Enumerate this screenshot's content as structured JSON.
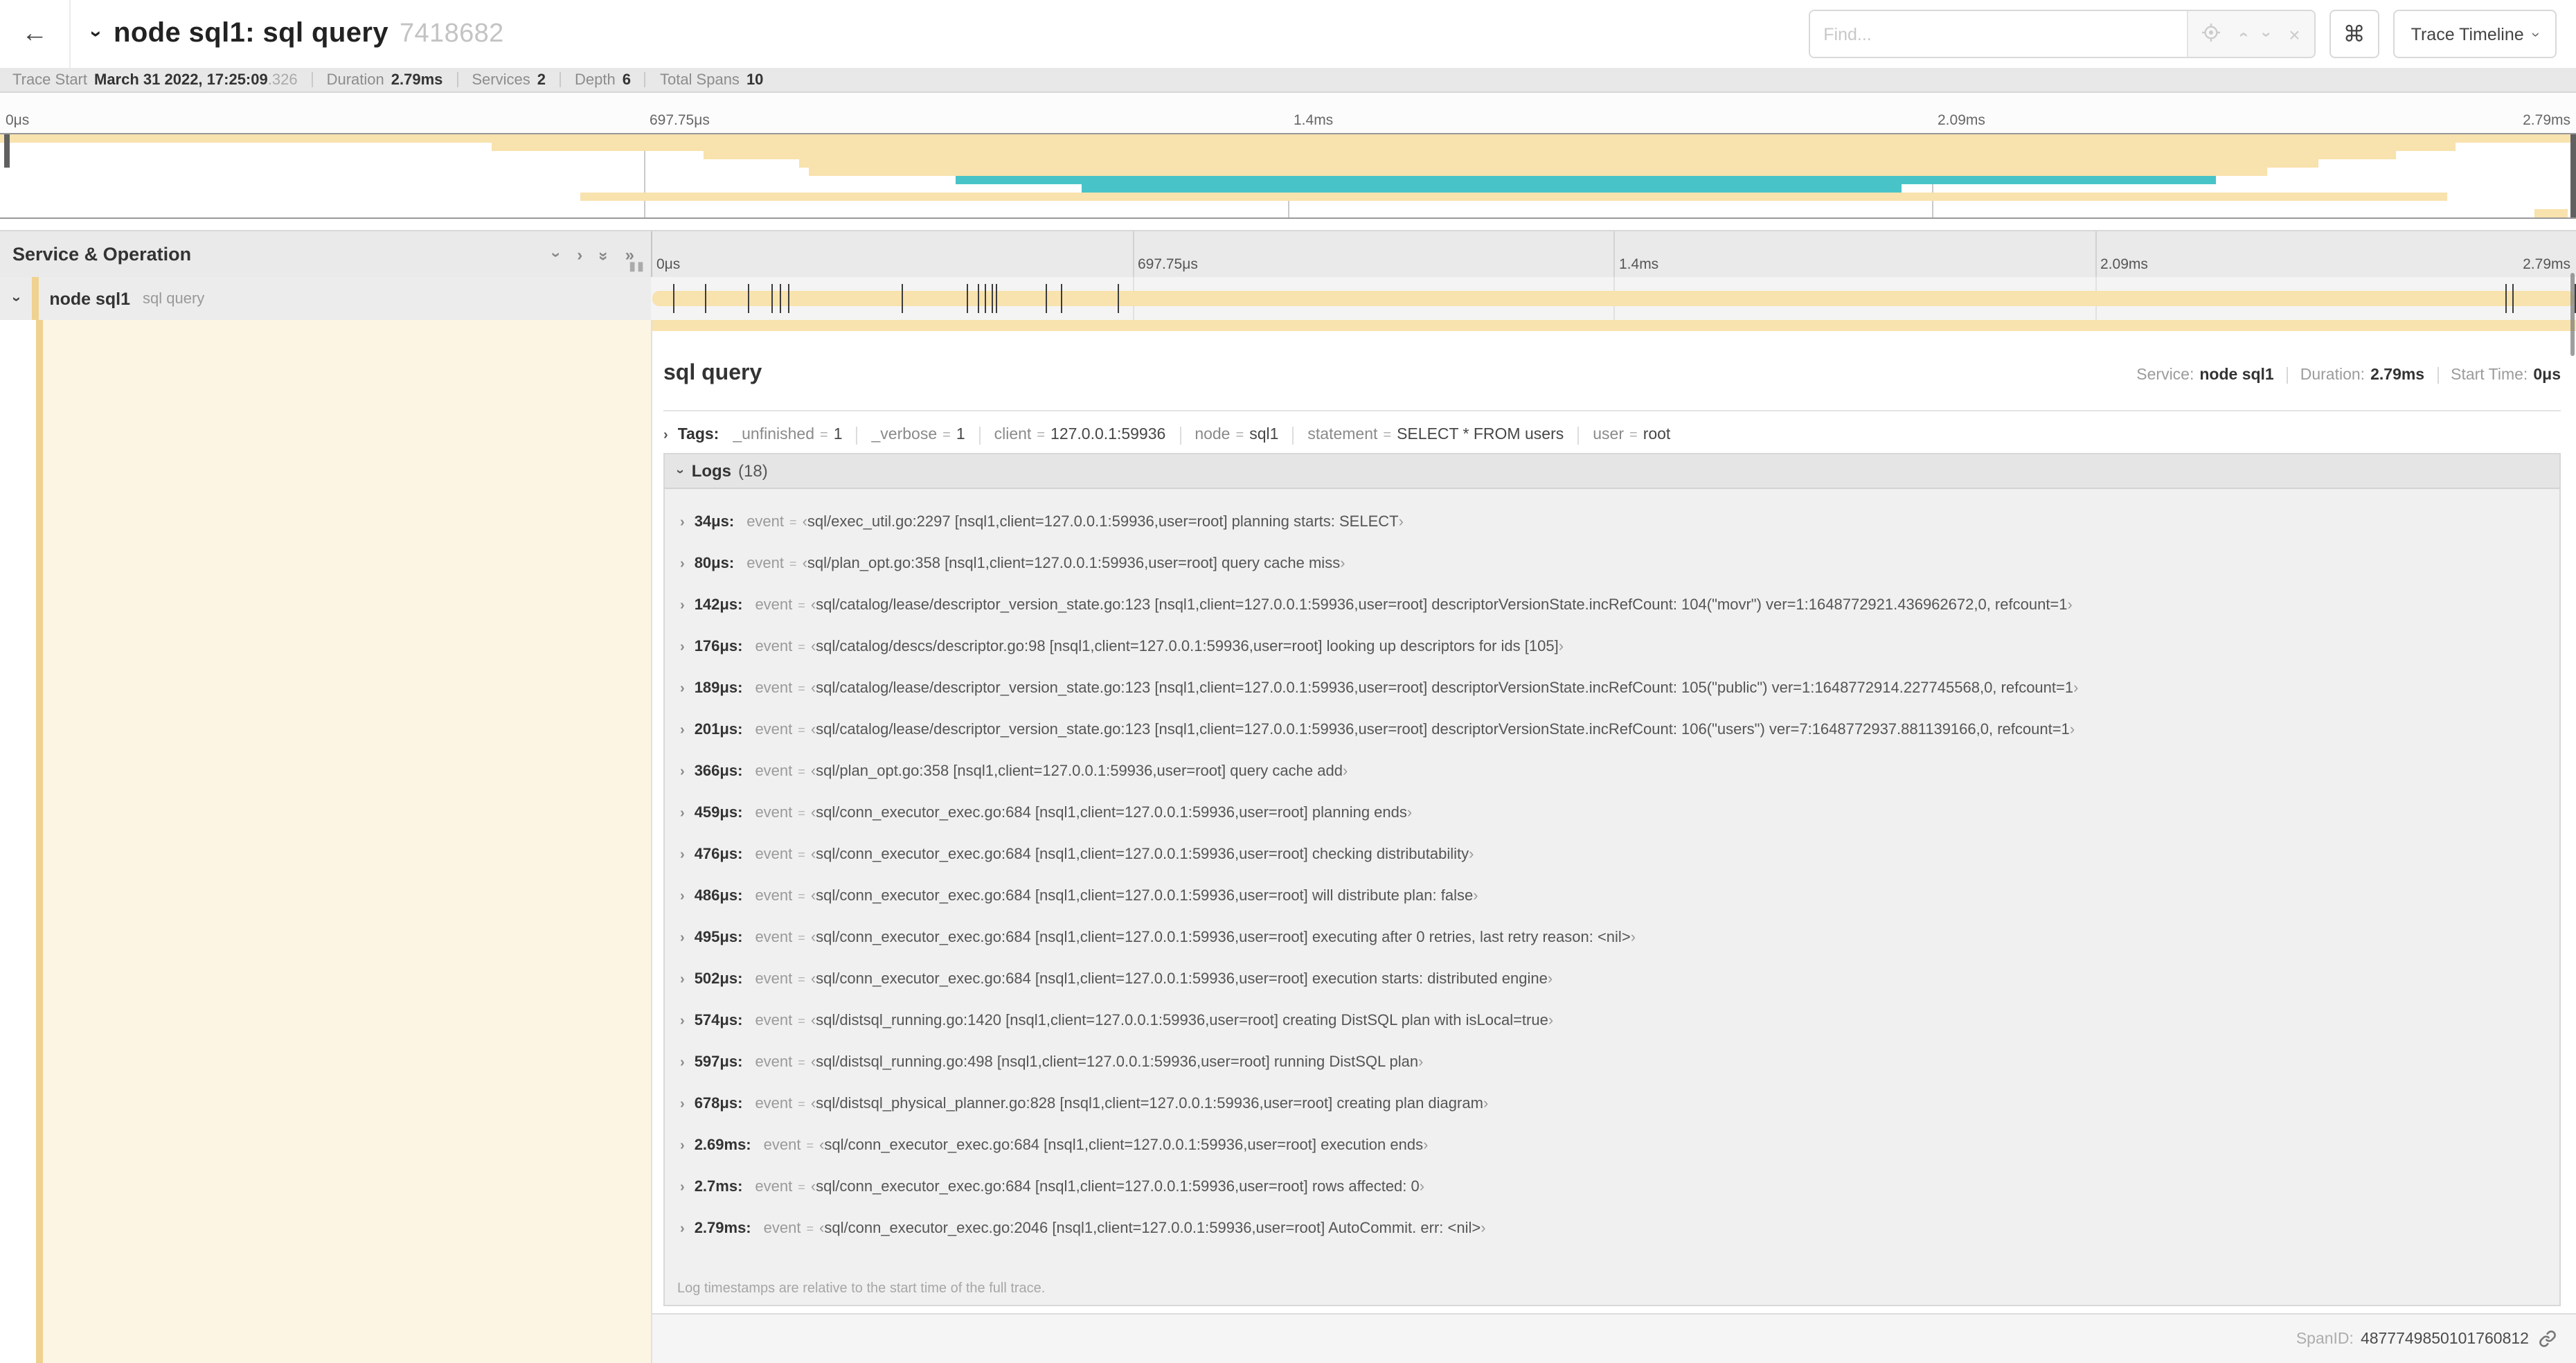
{
  "colors": {
    "tan_bar": "#f8e2ad",
    "tan_accent": "#efd28f",
    "teal": "#48c4c8",
    "cream": "#fdf5e3"
  },
  "header": {
    "back_icon": "←",
    "collapse_icon": "›",
    "title": "node sql1: sql query",
    "trace_id_short": "7418682",
    "find_placeholder": "Find...",
    "cmd_symbol": "⌘",
    "view_dropdown": "Trace Timeline"
  },
  "summary": {
    "items": [
      {
        "label": "Trace Start",
        "value": "March 31 2022, 17:25:09",
        "suffix": ".326"
      },
      {
        "label": "Duration",
        "value": "2.79ms",
        "suffix": ""
      },
      {
        "label": "Services",
        "value": "2",
        "suffix": ""
      },
      {
        "label": "Depth",
        "value": "6",
        "suffix": ""
      },
      {
        "label": "Total Spans",
        "value": "10",
        "suffix": ""
      }
    ]
  },
  "axis": {
    "labels": [
      {
        "text": "0μs",
        "pos": 0
      },
      {
        "text": "697.75μs",
        "pos": 25
      },
      {
        "text": "1.4ms",
        "pos": 50
      },
      {
        "text": "2.09ms",
        "pos": 75
      },
      {
        "text": "2.79ms",
        "pos": 100
      }
    ],
    "gridlines": [
      25,
      50,
      75,
      100
    ]
  },
  "minimap": {
    "rows": [
      {
        "row": 0,
        "start": 0,
        "end": 100,
        "color": "tan"
      },
      {
        "row": 1,
        "start": 19.1,
        "end": 95.3,
        "color": "tan"
      },
      {
        "row": 2,
        "start": 27.3,
        "end": 93,
        "color": "tan"
      },
      {
        "row": 3,
        "start": 31,
        "end": 90,
        "color": "tan"
      },
      {
        "row": 4,
        "start": 31.4,
        "end": 88,
        "color": "tan"
      },
      {
        "row": 5,
        "start": 37.1,
        "end": 86,
        "color": "teal"
      },
      {
        "row": 6,
        "start": 42,
        "end": 73.8,
        "color": "teal"
      },
      {
        "row": 7,
        "start": 22.5,
        "end": 95,
        "color": "tan"
      },
      {
        "row": 9,
        "start": 98.4,
        "end": 99.7,
        "color": "tan"
      }
    ]
  },
  "timeline": {
    "left_header": "Service & Operation",
    "span_row": {
      "service": "node sql1",
      "operation": "sql query"
    },
    "duration_us": 2790,
    "tick_times_us": [
      34,
      80,
      142,
      176,
      189,
      201,
      366,
      459,
      476,
      486,
      495,
      502,
      574,
      597,
      678,
      2690,
      2700,
      2790
    ]
  },
  "detail": {
    "title": "sql query",
    "meta": [
      {
        "label": "Service:",
        "value": "node sql1"
      },
      {
        "label": "Duration:",
        "value": "2.79ms"
      },
      {
        "label": "Start Time:",
        "value": "0μs"
      }
    ],
    "tags_label": "Tags:",
    "tags": [
      {
        "key": "_unfinished",
        "value": "1"
      },
      {
        "key": "_verbose",
        "value": "1"
      },
      {
        "key": "client",
        "value": "127.0.0.1:59936"
      },
      {
        "key": "node",
        "value": "sql1"
      },
      {
        "key": "statement",
        "value": "SELECT * FROM users"
      },
      {
        "key": "user",
        "value": "root"
      }
    ],
    "logs_label": "Logs",
    "logs_count": "(18)",
    "event_key": "event",
    "quote_open": "‹",
    "quote_close": "›",
    "logs": [
      {
        "time": "34μs:",
        "value": "sql/exec_util.go:2297 [nsql1,client=127.0.0.1:59936,user=root] planning starts: SELECT"
      },
      {
        "time": "80μs:",
        "value": "sql/plan_opt.go:358 [nsql1,client=127.0.0.1:59936,user=root] query cache miss"
      },
      {
        "time": "142μs:",
        "value": "sql/catalog/lease/descriptor_version_state.go:123 [nsql1,client=127.0.0.1:59936,user=root] descriptorVersionState.incRefCount: 104(\"movr\") ver=1:1648772921.436962672,0, refcount=1"
      },
      {
        "time": "176μs:",
        "value": "sql/catalog/descs/descriptor.go:98 [nsql1,client=127.0.0.1:59936,user=root] looking up descriptors for ids [105]"
      },
      {
        "time": "189μs:",
        "value": "sql/catalog/lease/descriptor_version_state.go:123 [nsql1,client=127.0.0.1:59936,user=root] descriptorVersionState.incRefCount: 105(\"public\") ver=1:1648772914.227745568,0, refcount=1"
      },
      {
        "time": "201μs:",
        "value": "sql/catalog/lease/descriptor_version_state.go:123 [nsql1,client=127.0.0.1:59936,user=root] descriptorVersionState.incRefCount: 106(\"users\") ver=7:1648772937.881139166,0, refcount=1"
      },
      {
        "time": "366μs:",
        "value": "sql/plan_opt.go:358 [nsql1,client=127.0.0.1:59936,user=root] query cache add"
      },
      {
        "time": "459μs:",
        "value": "sql/conn_executor_exec.go:684 [nsql1,client=127.0.0.1:59936,user=root] planning ends"
      },
      {
        "time": "476μs:",
        "value": "sql/conn_executor_exec.go:684 [nsql1,client=127.0.0.1:59936,user=root] checking distributability"
      },
      {
        "time": "486μs:",
        "value": "sql/conn_executor_exec.go:684 [nsql1,client=127.0.0.1:59936,user=root] will distribute plan: false"
      },
      {
        "time": "495μs:",
        "value": "sql/conn_executor_exec.go:684 [nsql1,client=127.0.0.1:59936,user=root] executing after 0 retries, last retry reason: <nil>"
      },
      {
        "time": "502μs:",
        "value": "sql/conn_executor_exec.go:684 [nsql1,client=127.0.0.1:59936,user=root] execution starts: distributed engine"
      },
      {
        "time": "574μs:",
        "value": "sql/distsql_running.go:1420 [nsql1,client=127.0.0.1:59936,user=root] creating DistSQL plan with isLocal=true"
      },
      {
        "time": "597μs:",
        "value": "sql/distsql_running.go:498 [nsql1,client=127.0.0.1:59936,user=root] running DistSQL plan"
      },
      {
        "time": "678μs:",
        "value": "sql/distsql_physical_planner.go:828 [nsql1,client=127.0.0.1:59936,user=root] creating plan diagram"
      },
      {
        "time": "2.69ms:",
        "value": "sql/conn_executor_exec.go:684 [nsql1,client=127.0.0.1:59936,user=root] execution ends"
      },
      {
        "time": "2.7ms:",
        "value": "sql/conn_executor_exec.go:684 [nsql1,client=127.0.0.1:59936,user=root] rows affected: 0"
      },
      {
        "time": "2.79ms:",
        "value": "sql/conn_executor_exec.go:2046 [nsql1,client=127.0.0.1:59936,user=root] AutoCommit. err: <nil>"
      }
    ],
    "logs_footnote": "Log timestamps are relative to the start time of the full trace.",
    "span_id_label": "SpanID:",
    "span_id": "4877749850101760812"
  }
}
